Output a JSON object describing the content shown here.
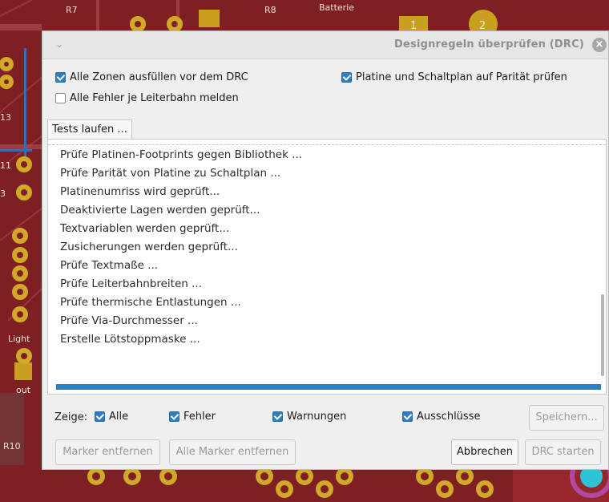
{
  "colors": {
    "accent": "#2d7fc0",
    "pcb_board": "#7e1f24",
    "pad_gold": "#c8a01e"
  },
  "background": {
    "pcb_labels": [
      "Batterie",
      "1",
      "2",
      "Light",
      "3",
      "11",
      "13",
      "out",
      "R10",
      "R7",
      "R8"
    ]
  },
  "dialog": {
    "title": "Designregeln überprüfen (DRC)",
    "options": {
      "fill_zones_label": "Alle Zonen ausfüllen vor dem DRC",
      "fill_zones_checked": true,
      "parity_label": "Platine und Schaltplan auf Parität prüfen",
      "parity_checked": true,
      "all_errors_label": "Alle Fehler je Leiterbahn melden",
      "all_errors_checked": false
    },
    "tab_label": "Tests laufen ...",
    "log": [
      "Prüfe Platinen-Footprints gegen Bibliothek ...",
      "Prüfe Parität von Platine zu Schaltplan ...",
      "Platinenumriss wird geprüft...",
      "Deaktivierte Lagen werden geprüft...",
      "Textvariablen werden geprüft...",
      "Zusicherungen werden geprüft...",
      "Prüfe Textmaße ...",
      "Prüfe Leiterbahnbreiten ...",
      "Prüfe thermische Entlastungen ...",
      "Prüfe Via-Durchmesser ...",
      "Erstelle Lötstoppmaske ..."
    ],
    "progress": 1.0,
    "filter": {
      "label": "Zeige:",
      "all": "Alle",
      "errors": "Fehler",
      "warnings": "Warnungen",
      "exclusions": "Ausschlüsse",
      "save_button": "Speichern..."
    },
    "buttons": {
      "remove_markers": "Marker entfernen",
      "remove_all_markers": "Alle Marker entfernen",
      "cancel": "Abbrechen",
      "run_drc": "DRC starten"
    }
  }
}
